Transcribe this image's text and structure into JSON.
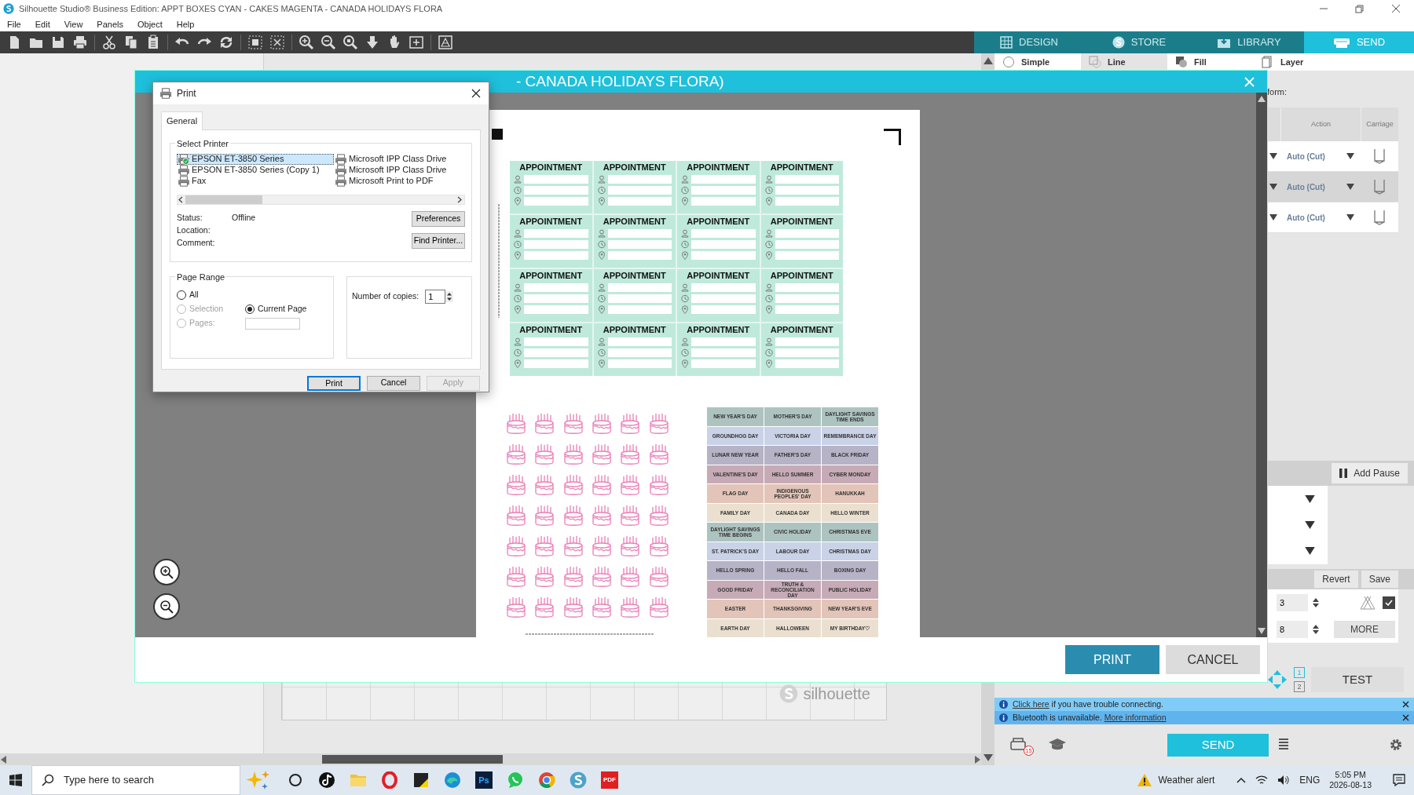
{
  "window": {
    "title": "Silhouette Studio® Business Edition: APPT BOXES CYAN - CAKES MAGENTA - CANADA HOLIDAYS FLORA"
  },
  "menu": [
    "File",
    "Edit",
    "View",
    "Panels",
    "Object",
    "Help"
  ],
  "mode_tabs": [
    {
      "label": "DESIGN",
      "kind": "grid",
      "selected": false
    },
    {
      "label": "STORE",
      "kind": "store",
      "selected": false
    },
    {
      "label": "LIBRARY",
      "kind": "library",
      "selected": false
    },
    {
      "label": "SEND",
      "kind": "send",
      "selected": true
    }
  ],
  "workspace": {
    "mat_logo": "silhouette"
  },
  "panel": {
    "style_tabs": [
      {
        "label": "Simple",
        "kind": "circle",
        "selected": false
      },
      {
        "label": "Line",
        "kind": "line",
        "selected": true
      },
      {
        "label": "Fill",
        "kind": "fill",
        "selected": false
      },
      {
        "label": "Layer",
        "kind": "layer",
        "selected": false
      }
    ],
    "section_label": "form:",
    "columns": [
      "Action",
      "Carriage"
    ],
    "rows": [
      {
        "action": "Auto (Cut)",
        "selected": false
      },
      {
        "action": "Auto (Cut)",
        "selected": true
      },
      {
        "action": "Auto (Cut)",
        "selected": false
      }
    ],
    "add_pause": "Add Pause",
    "revert": "Revert",
    "save": "Save",
    "spin_values": [
      "3",
      "8"
    ],
    "checkbox_checked": true,
    "more": "MORE",
    "pages": [
      {
        "label": "1",
        "selected": true
      },
      {
        "label": "2",
        "selected": false
      }
    ],
    "test": "TEST",
    "notices": [
      {
        "parts": [
          {
            "kind": "link",
            "text": "Click here"
          },
          {
            "kind": "plain",
            "text": "if you have trouble connecting."
          }
        ]
      },
      {
        "parts": [
          {
            "kind": "plain",
            "text": "Bluetooth is unavailable."
          },
          {
            "kind": "link",
            "text": "More information"
          }
        ]
      }
    ],
    "alert_badge": "15",
    "send": "SEND"
  },
  "print_preview": {
    "title": "- CANADA HOLIDAYS FLORA)",
    "sheet": {
      "appointments": [
        {
          "title": "APPOINTMENT"
        },
        {
          "title": "APPOINTMENT"
        },
        {
          "title": "APPOINTMENT"
        },
        {
          "title": "APPOINTMENT"
        },
        {
          "title": "APPOINTMENT"
        },
        {
          "title": "APPOINTMENT"
        },
        {
          "title": "APPOINTMENT"
        },
        {
          "title": "APPOINTMENT"
        },
        {
          "title": "APPOINTMENT"
        },
        {
          "title": "APPOINTMENT"
        },
        {
          "title": "APPOINTMENT"
        },
        {
          "title": "APPOINTMENT"
        },
        {
          "title": "APPOINTMENT"
        },
        {
          "title": "APPOINTMENT"
        },
        {
          "title": "APPOINTMENT"
        },
        {
          "title": "APPOINTMENT"
        }
      ],
      "holiday_rows": [
        {
          "color": "#adc3bf",
          "labels": [
            "NEW YEAR'S DAY",
            "MOTHER'S DAY",
            "DAYLIGHT SAVINGS TIME ENDS"
          ]
        },
        {
          "color": "#c9d2e6",
          "labels": [
            "GROUNDHOG DAY",
            "VICTORIA DAY",
            "REMEMBRANCE DAY"
          ]
        },
        {
          "color": "#b6b3c7",
          "labels": [
            "LUNAR NEW YEAR",
            "FATHER'S DAY",
            "BLACK FRIDAY"
          ]
        },
        {
          "color": "#c6abb6",
          "labels": [
            "VALENTINE'S DAY",
            "HELLO SUMMER",
            "CYBER MONDAY"
          ]
        },
        {
          "color": "#e3c4b8",
          "labels": [
            "FLAG DAY",
            "INDIGENOUS PEOPLES' DAY",
            "HANUKKAH"
          ]
        },
        {
          "color": "#ebe0d0",
          "labels": [
            "FAMILY DAY",
            "CANADA DAY",
            "HELLO WINTER"
          ]
        },
        {
          "color": "#adc3bf",
          "labels": [
            "DAYLIGHT SAVINGS TIME BEGINS",
            "CIVIC HOLIDAY",
            "CHRISTMAS EVE"
          ]
        },
        {
          "color": "#c9d2e6",
          "labels": [
            "ST. PATRICK'S DAY",
            "LABOUR DAY",
            "CHRISTMAS DAY"
          ]
        },
        {
          "color": "#b6b3c7",
          "labels": [
            "HELLO SPRING",
            "HELLO FALL",
            "BOXING DAY"
          ]
        },
        {
          "color": "#c6abb6",
          "labels": [
            "GOOD FRIDAY",
            "TRUTH & RECONCILIATION DAY",
            "PUBLIC HOLIDAY"
          ]
        },
        {
          "color": "#e3c4b8",
          "labels": [
            "EASTER",
            "THANKSGIVING",
            "NEW YEAR'S EVE"
          ]
        },
        {
          "color": "#ebe0d0",
          "labels": [
            "EARTH DAY",
            "HALLOWEEN",
            "MY BIRTHDAY♡"
          ]
        }
      ]
    },
    "buttons": [
      {
        "label": "PRINT",
        "kind": "primary"
      },
      {
        "label": "CANCEL",
        "kind": "secondary"
      }
    ]
  },
  "print_dialog": {
    "title": "Print",
    "tabs": [
      {
        "label": "General",
        "selected": true
      }
    ],
    "printer_group": "Select Printer",
    "printers": [
      {
        "name": "EPSON ET-3850 Series",
        "selected": true,
        "default": true
      },
      {
        "name": "EPSON ET-3850 Series (Copy 1)",
        "selected": false,
        "default": false
      },
      {
        "name": "Fax",
        "selected": false,
        "default": false
      },
      {
        "name": "Microsoft IPP Class Drive",
        "selected": false,
        "default": false
      },
      {
        "name": "Microsoft IPP Class Drive",
        "selected": false,
        "default": false
      },
      {
        "name": "Microsoft Print to PDF",
        "selected": false,
        "default": false
      }
    ],
    "info": [
      {
        "label": "Status:",
        "value": "Offline"
      },
      {
        "label": "Location:"
      },
      {
        "label": "Comment:"
      }
    ],
    "side_buttons": [
      "Preferences",
      "Find Printer..."
    ],
    "range_group": "Page Range",
    "ranges": [
      {
        "label": "All",
        "selected": false,
        "disabled": false
      },
      {
        "label": "Selection",
        "selected": false,
        "disabled": true
      },
      {
        "label": "Current Page",
        "selected": true,
        "disabled": false
      },
      {
        "label": "Pages:",
        "selected": false,
        "disabled": true
      }
    ],
    "copies": {
      "label": "Number of copies:",
      "value": "1"
    },
    "buttons": [
      {
        "label": "Print",
        "kind": "default",
        "disabled": false
      },
      {
        "label": "Cancel",
        "kind": "normal",
        "disabled": false
      },
      {
        "label": "Apply",
        "kind": "normal",
        "disabled": true
      }
    ]
  },
  "taskbar": {
    "search_placeholder": "Type here to search",
    "apps": [
      {
        "kind": "ring"
      },
      {
        "kind": "note"
      },
      {
        "kind": "folder"
      },
      {
        "kind": "o"
      },
      {
        "kind": "sticky"
      },
      {
        "kind": "swirl"
      },
      {
        "kind": "text",
        "label": "Ps"
      },
      {
        "kind": "chat"
      },
      {
        "kind": "wheel"
      },
      {
        "kind": "s"
      },
      {
        "kind": "text",
        "label": "PDF"
      }
    ],
    "weather": "Weather alert",
    "language": "ENG",
    "time": "5:05 PM",
    "date": "2026-08-13"
  }
}
